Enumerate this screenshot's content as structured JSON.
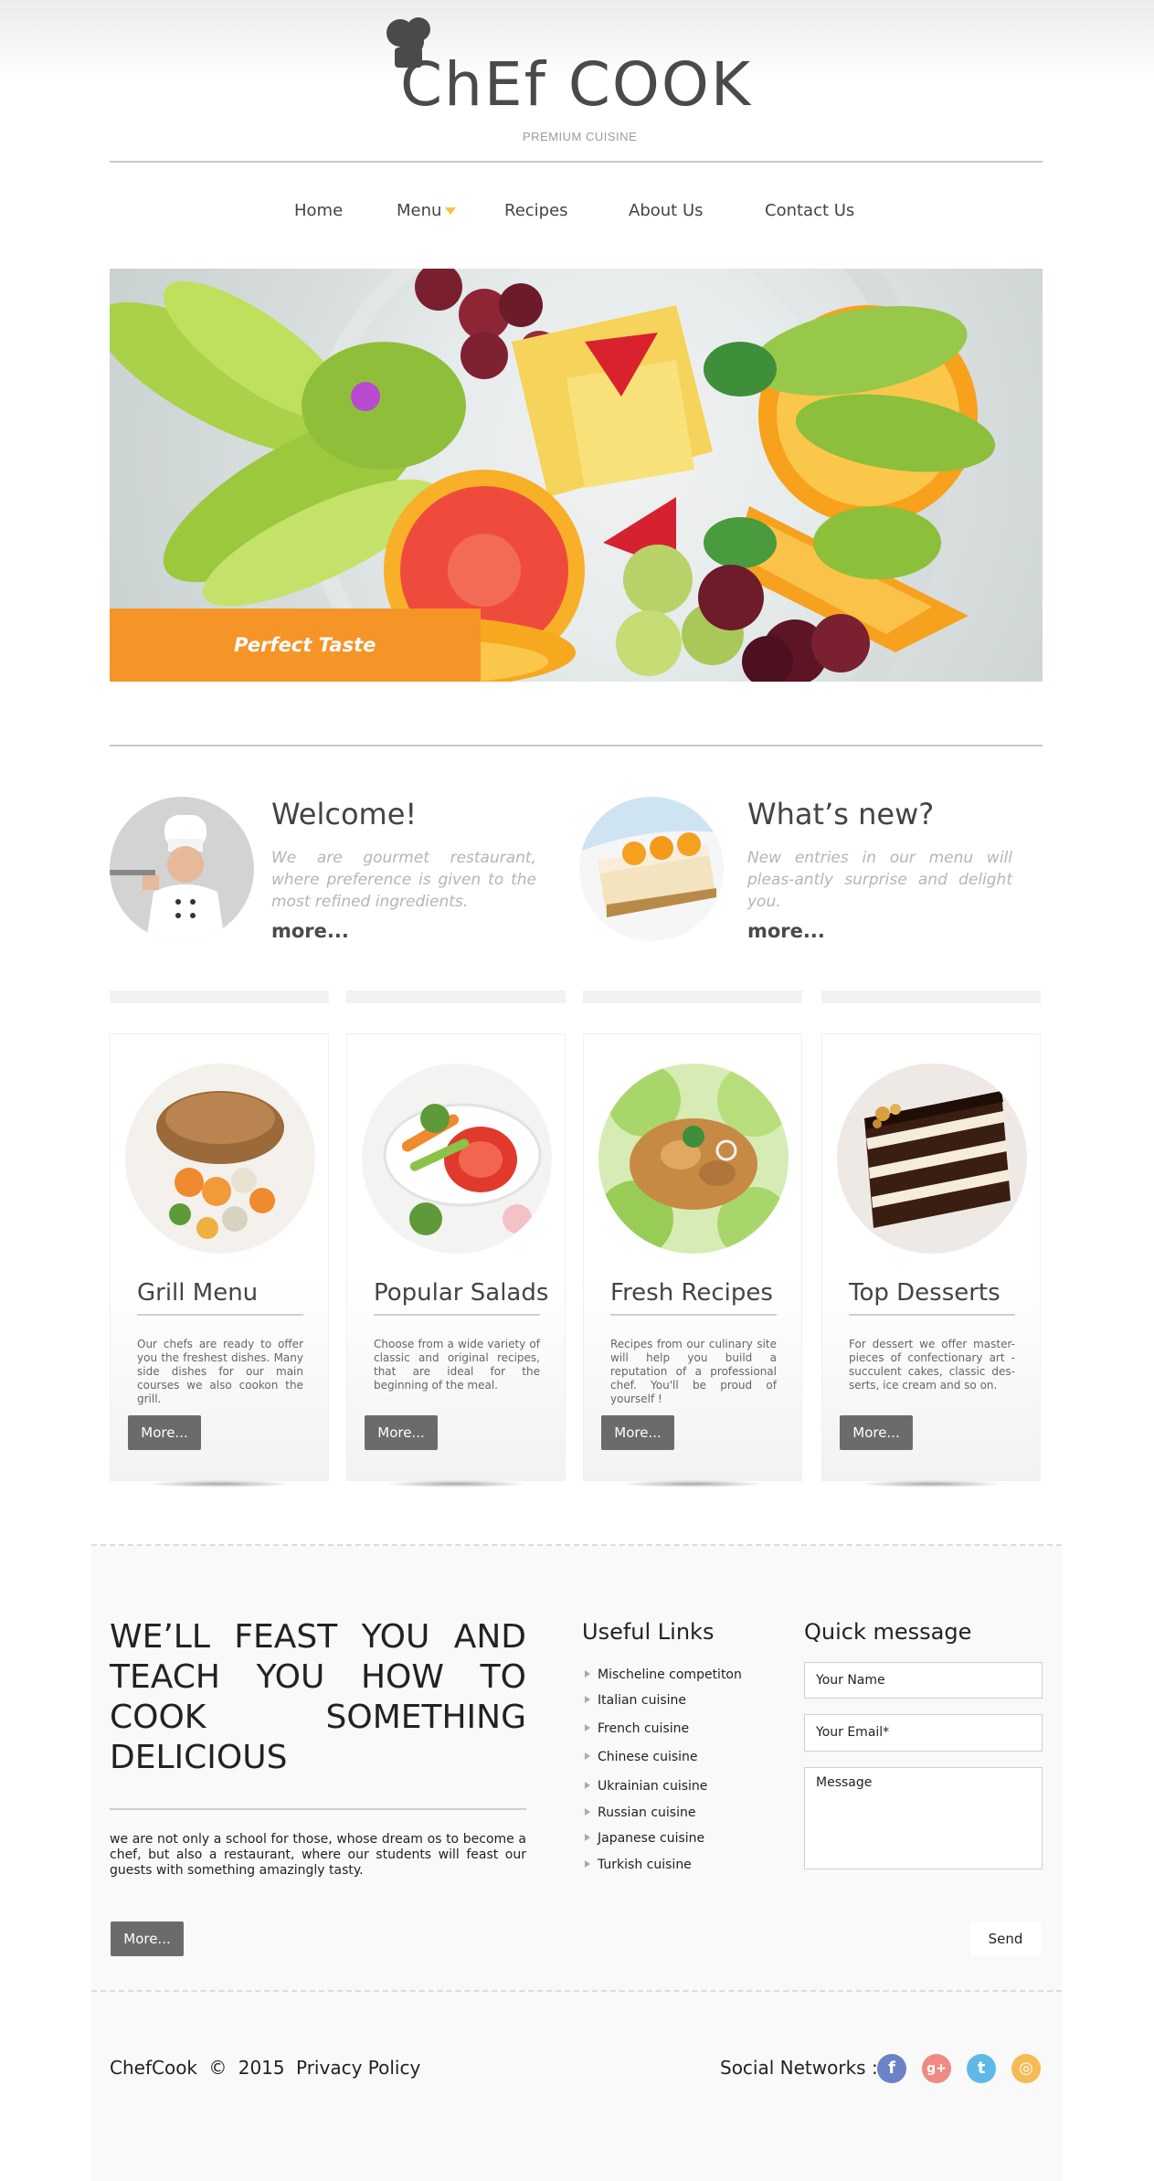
{
  "brand": {
    "logo": "ChEf COOK",
    "tagline": "PREMIUM CUISINE"
  },
  "nav": {
    "items": [
      "Home",
      "Menu",
      "Recipes",
      "About Us",
      "Contact Us"
    ]
  },
  "hero": {
    "caption": "Perfect Taste"
  },
  "welcome": {
    "title": "Welcome!",
    "text": "We are gourmet restaurant, where preference is given to the most refined ingredients.",
    "more": "more..."
  },
  "whats_new": {
    "title": "What’s new?",
    "text": "New entries in our menu will pleas-antly surprise and delight you.",
    "more": "more..."
  },
  "cards": [
    {
      "title": "Grill Menu",
      "text": "Our chefs are ready to offer you the freshest dishes. Many side dishes for our main courses we also cookon the grill.",
      "button": "More..."
    },
    {
      "title": "Popular Salads",
      "text": "Choose from a wide variety of classic and original recipes, that are ideal for the beginning of the meal.",
      "button": "More..."
    },
    {
      "title": "Fresh Recipes",
      "text": "Recipes from our culinary site will help you build a reputation of a professional chef. You'll be proud of yourself !",
      "button": "More..."
    },
    {
      "title": "Top Desserts",
      "text": "For dessert we offer master-pieces of confectionary art - succulent cakes, classic des-serts, ice cream and so on.",
      "button": "More..."
    }
  ],
  "feast": {
    "title": "WE’LL FEAST YOU AND TEACH YOU HOW TO COOK SOMETHING DELICIOUS",
    "text": "we are not only a school for those, whose dream os to become a chef, but also a restaurant, where our students will feast our guests with something amazingly tasty.",
    "button": "More..."
  },
  "useful_links": {
    "title": "Useful Links",
    "items": [
      "Mischeline competiton",
      "Italian cuisine",
      "French cuisine",
      "Chinese cuisine",
      "Ukrainian cuisine",
      "Russian cuisine",
      "Japanese cuisine",
      "Turkish cuisine"
    ]
  },
  "quick_message": {
    "title": "Quick message",
    "name_placeholder": "Your Name",
    "email_placeholder": "Your Email*",
    "message_placeholder": "Message",
    "send": "Send"
  },
  "footer": {
    "brand": "ChefCook",
    "copyright_symbol": "©",
    "year": "2015",
    "privacy": "Privacy Policy",
    "social_label": "Social Networks :",
    "social": [
      {
        "icon": "facebook-icon",
        "glyph": "f",
        "color": "#6b82c4"
      },
      {
        "icon": "google-plus-icon",
        "glyph": "g+",
        "color": "#f08a84"
      },
      {
        "icon": "twitter-icon",
        "glyph": "t",
        "color": "#5fb9e6"
      },
      {
        "icon": "instagram-icon",
        "glyph": "◎",
        "color": "#f5bb55"
      }
    ]
  },
  "colors": {
    "accent_orange": "#f59427",
    "button_dark": "#6b6b6b",
    "caret_yellow": "#f0c34a"
  }
}
